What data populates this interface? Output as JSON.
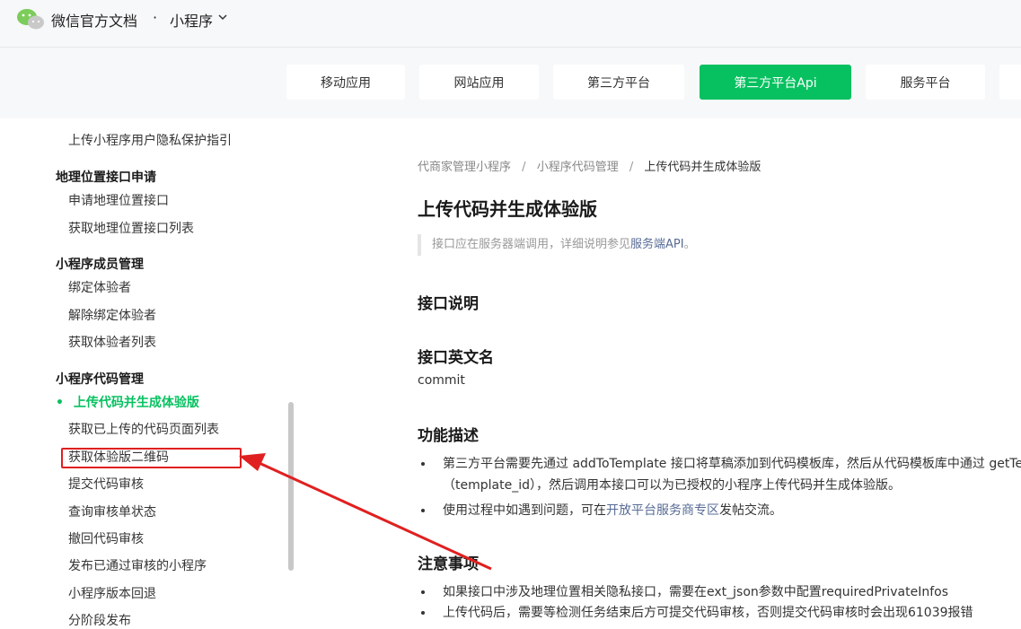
{
  "header": {
    "site_title": "微信官方文档",
    "separator": "·",
    "product": "小程序"
  },
  "nav": {
    "tabs": [
      {
        "label": "移动应用"
      },
      {
        "label": "网站应用"
      },
      {
        "label": "第三方平台"
      },
      {
        "label": "第三方平台Api",
        "active": true
      },
      {
        "label": "服务平台"
      }
    ]
  },
  "sidebar": {
    "items": [
      {
        "label": "上传小程序用户隐私保护指引"
      },
      {
        "group": "地理位置接口申请"
      },
      {
        "label": "申请地理位置接口"
      },
      {
        "label": "获取地理位置接口列表"
      },
      {
        "group": "小程序成员管理"
      },
      {
        "label": "绑定体验者"
      },
      {
        "label": "解除绑定体验者"
      },
      {
        "label": "获取体验者列表"
      },
      {
        "group": "小程序代码管理"
      },
      {
        "label": "上传代码并生成体验版",
        "active": true
      },
      {
        "label": "获取已上传的代码页面列表"
      },
      {
        "label": "获取体验版二维码",
        "highlighted": true
      },
      {
        "label": "提交代码审核"
      },
      {
        "label": "查询审核单状态"
      },
      {
        "label": "撤回代码审核"
      },
      {
        "label": "发布已通过审核的小程序"
      },
      {
        "label": "小程序版本回退"
      },
      {
        "label": "分阶段发布"
      }
    ],
    "active_bullet": "•"
  },
  "main": {
    "breadcrumb": [
      "代商家管理小程序",
      "小程序代码管理",
      "上传代码并生成体验版"
    ],
    "breadcrumb_sep": "/",
    "title": "上传代码并生成体验版",
    "note_prefix": "接口应在服务器端调用，详细说明参见",
    "note_link": "服务端API",
    "note_suffix": "。",
    "section_interface": "接口说明",
    "section_english_name": "接口英文名",
    "english_name": "commit",
    "section_function": "功能描述",
    "function_bullets": [
      {
        "text": "第三方平台需要先通过 addToTemplate 接口将草稿添加到代码模板库，然后从代码模板库中通过 getTem",
        "cont": "（template_id），然后调用本接口可以为已授权的小程序上传代码并生成体验版。"
      },
      {
        "text_prefix": "使用过程中如遇到问题，可在",
        "link": "开放平台服务商专区",
        "text_suffix": "发帖交流。"
      }
    ],
    "section_notes": "注意事项",
    "notes_bullets": [
      {
        "text": "如果接口中涉及地理位置相关隐私接口，需要在ext_json参数中配置requiredPrivateInfos"
      },
      {
        "text": "上传代码后，需要等检测任务结束后方可提交代码审核，否则提交代码审核时会出现61039报错"
      }
    ]
  },
  "colors": {
    "accent": "#07c160",
    "link": "#576b95",
    "annotation_red": "#e02020"
  }
}
